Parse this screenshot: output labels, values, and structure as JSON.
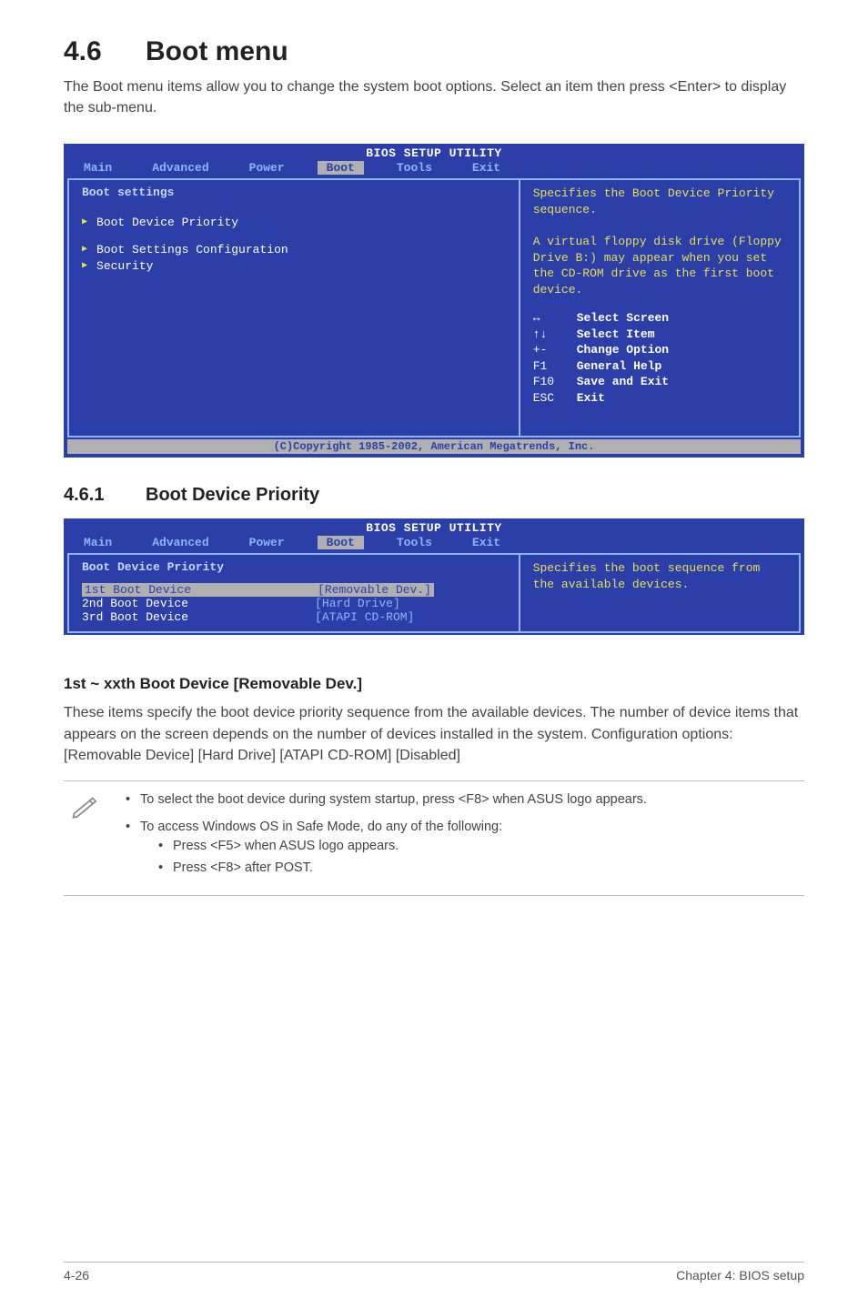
{
  "heading": {
    "num": "4.6",
    "title": "Boot menu"
  },
  "intro": "The Boot menu items allow you to change the system boot options. Select an item then press <Enter> to display the sub-menu.",
  "bios1": {
    "title": "BIOS SETUP UTILITY",
    "tabs": [
      "Main",
      "Advanced",
      "Power",
      "Boot",
      "Tools",
      "Exit"
    ],
    "selected_tab": "Boot",
    "section_title": "Boot settings",
    "items": [
      "Boot Device Priority",
      "Boot Settings Configuration",
      "Security"
    ],
    "help_text": "Specifies the Boot Device Priority sequence.\n\nA virtual floppy disk drive (Floppy Drive B:) may appear when you set the CD-ROM drive as the first boot device.",
    "keys": [
      {
        "k": "↔",
        "d": "Select Screen"
      },
      {
        "k": "↑↓",
        "d": "Select Item"
      },
      {
        "k": "+-",
        "d": "Change Option"
      },
      {
        "k": "F1",
        "d": "General Help"
      },
      {
        "k": "F10",
        "d": "Save and Exit"
      },
      {
        "k": "ESC",
        "d": "Exit"
      }
    ],
    "footer": "(C)Copyright 1985-2002, American Megatrends, Inc."
  },
  "sub": {
    "num": "4.6.1",
    "title": "Boot Device Priority"
  },
  "bios2": {
    "title": "BIOS SETUP UTILITY",
    "tabs": [
      "Main",
      "Advanced",
      "Power",
      "Boot",
      "Tools",
      "Exit"
    ],
    "selected_tab": "Boot",
    "section_title": "Boot Device Priority",
    "rows": [
      {
        "lbl": "1st Boot Device",
        "val": "[Removable Dev.]",
        "sel": true
      },
      {
        "lbl": "2nd Boot Device",
        "val": "[Hard Drive]",
        "sel": false
      },
      {
        "lbl": "3rd Boot Device",
        "val": "[ATAPI CD-ROM]",
        "sel": false
      }
    ],
    "help_text": "Specifies the boot sequence from the available devices."
  },
  "h3": "1st ~ xxth Boot Device [Removable Dev.]",
  "para2": "These items specify the boot device priority sequence from the available devices. The number of device items that appears on the screen depends on the number of devices installed in the system. Configuration options: [Removable Device] [Hard Drive] [ATAPI CD-ROM] [Disabled]",
  "note": {
    "b1": "To select the boot device during system startup, press <F8> when ASUS logo appears.",
    "b2": "To access Windows OS in Safe Mode, do any of the following:",
    "b2a": "Press <F5> when ASUS logo appears.",
    "b2b": "Press <F8> after POST."
  },
  "footer": {
    "left": "4-26",
    "right": "Chapter 4: BIOS setup"
  }
}
